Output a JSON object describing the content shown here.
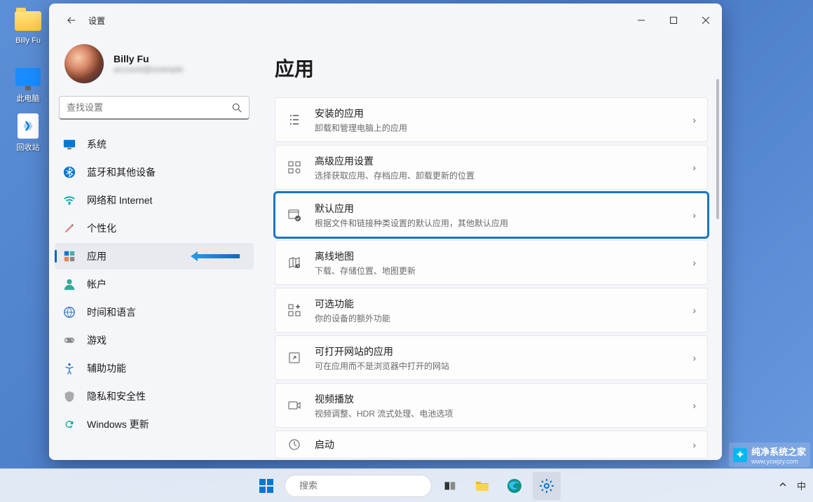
{
  "desktop": {
    "icons": [
      {
        "label": "Billy Fu"
      },
      {
        "label": "此电脑"
      },
      {
        "label": "回收站"
      }
    ]
  },
  "window": {
    "title": "设置",
    "profile": {
      "name": "Billy Fu",
      "email": "account@example"
    },
    "search": {
      "placeholder": "查找设置"
    }
  },
  "sidebar": {
    "items": [
      {
        "label": "系统",
        "icon": "display"
      },
      {
        "label": "蓝牙和其他设备",
        "icon": "bluetooth"
      },
      {
        "label": "网络和 Internet",
        "icon": "wifi"
      },
      {
        "label": "个性化",
        "icon": "brush"
      },
      {
        "label": "应用",
        "icon": "apps",
        "active": true
      },
      {
        "label": "帐户",
        "icon": "person"
      },
      {
        "label": "时间和语言",
        "icon": "globe"
      },
      {
        "label": "游戏",
        "icon": "gamepad"
      },
      {
        "label": "辅助功能",
        "icon": "accessibility"
      },
      {
        "label": "隐私和安全性",
        "icon": "shield"
      },
      {
        "label": "Windows 更新",
        "icon": "update"
      }
    ]
  },
  "main": {
    "heading": "应用",
    "cards": [
      {
        "title": "安装的应用",
        "sub": "卸载和管理电脑上的应用",
        "icon": "list"
      },
      {
        "title": "高级应用设置",
        "sub": "选择获取应用、存档应用、卸载更新的位置",
        "icon": "grid-gear"
      },
      {
        "title": "默认应用",
        "sub": "根据文件和链接种类设置的默认应用，其他默认应用",
        "icon": "window-check",
        "highlight": true
      },
      {
        "title": "离线地图",
        "sub": "下载、存储位置、地图更新",
        "icon": "map"
      },
      {
        "title": "可选功能",
        "sub": "你的设备的额外功能",
        "icon": "grid-plus"
      },
      {
        "title": "可打开网站的应用",
        "sub": "可在应用而不是浏览器中打开的网站",
        "icon": "open-ext"
      },
      {
        "title": "视频播放",
        "sub": "视频调整、HDR 流式处理、电池选项",
        "icon": "video"
      },
      {
        "title": "启动",
        "sub": "",
        "icon": "startup"
      }
    ]
  },
  "taskbar": {
    "search_placeholder": "搜索",
    "tray": {
      "lang": "中"
    }
  },
  "watermark": {
    "title": "纯净系统之家",
    "sub": "www.ycwjzy.com"
  }
}
